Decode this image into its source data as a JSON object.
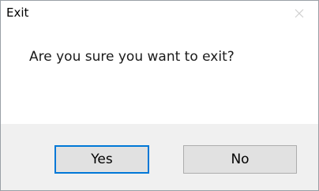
{
  "dialog": {
    "title": "Exit",
    "message": "Are you sure you want to exit?",
    "buttons": {
      "yes_label": "Yes",
      "no_label": "No"
    },
    "close_icon": "close-icon",
    "colors": {
      "default_button_border": "#0078d7",
      "button_bar_background": "#f0f0f0",
      "button_background": "#e1e1e1"
    }
  }
}
